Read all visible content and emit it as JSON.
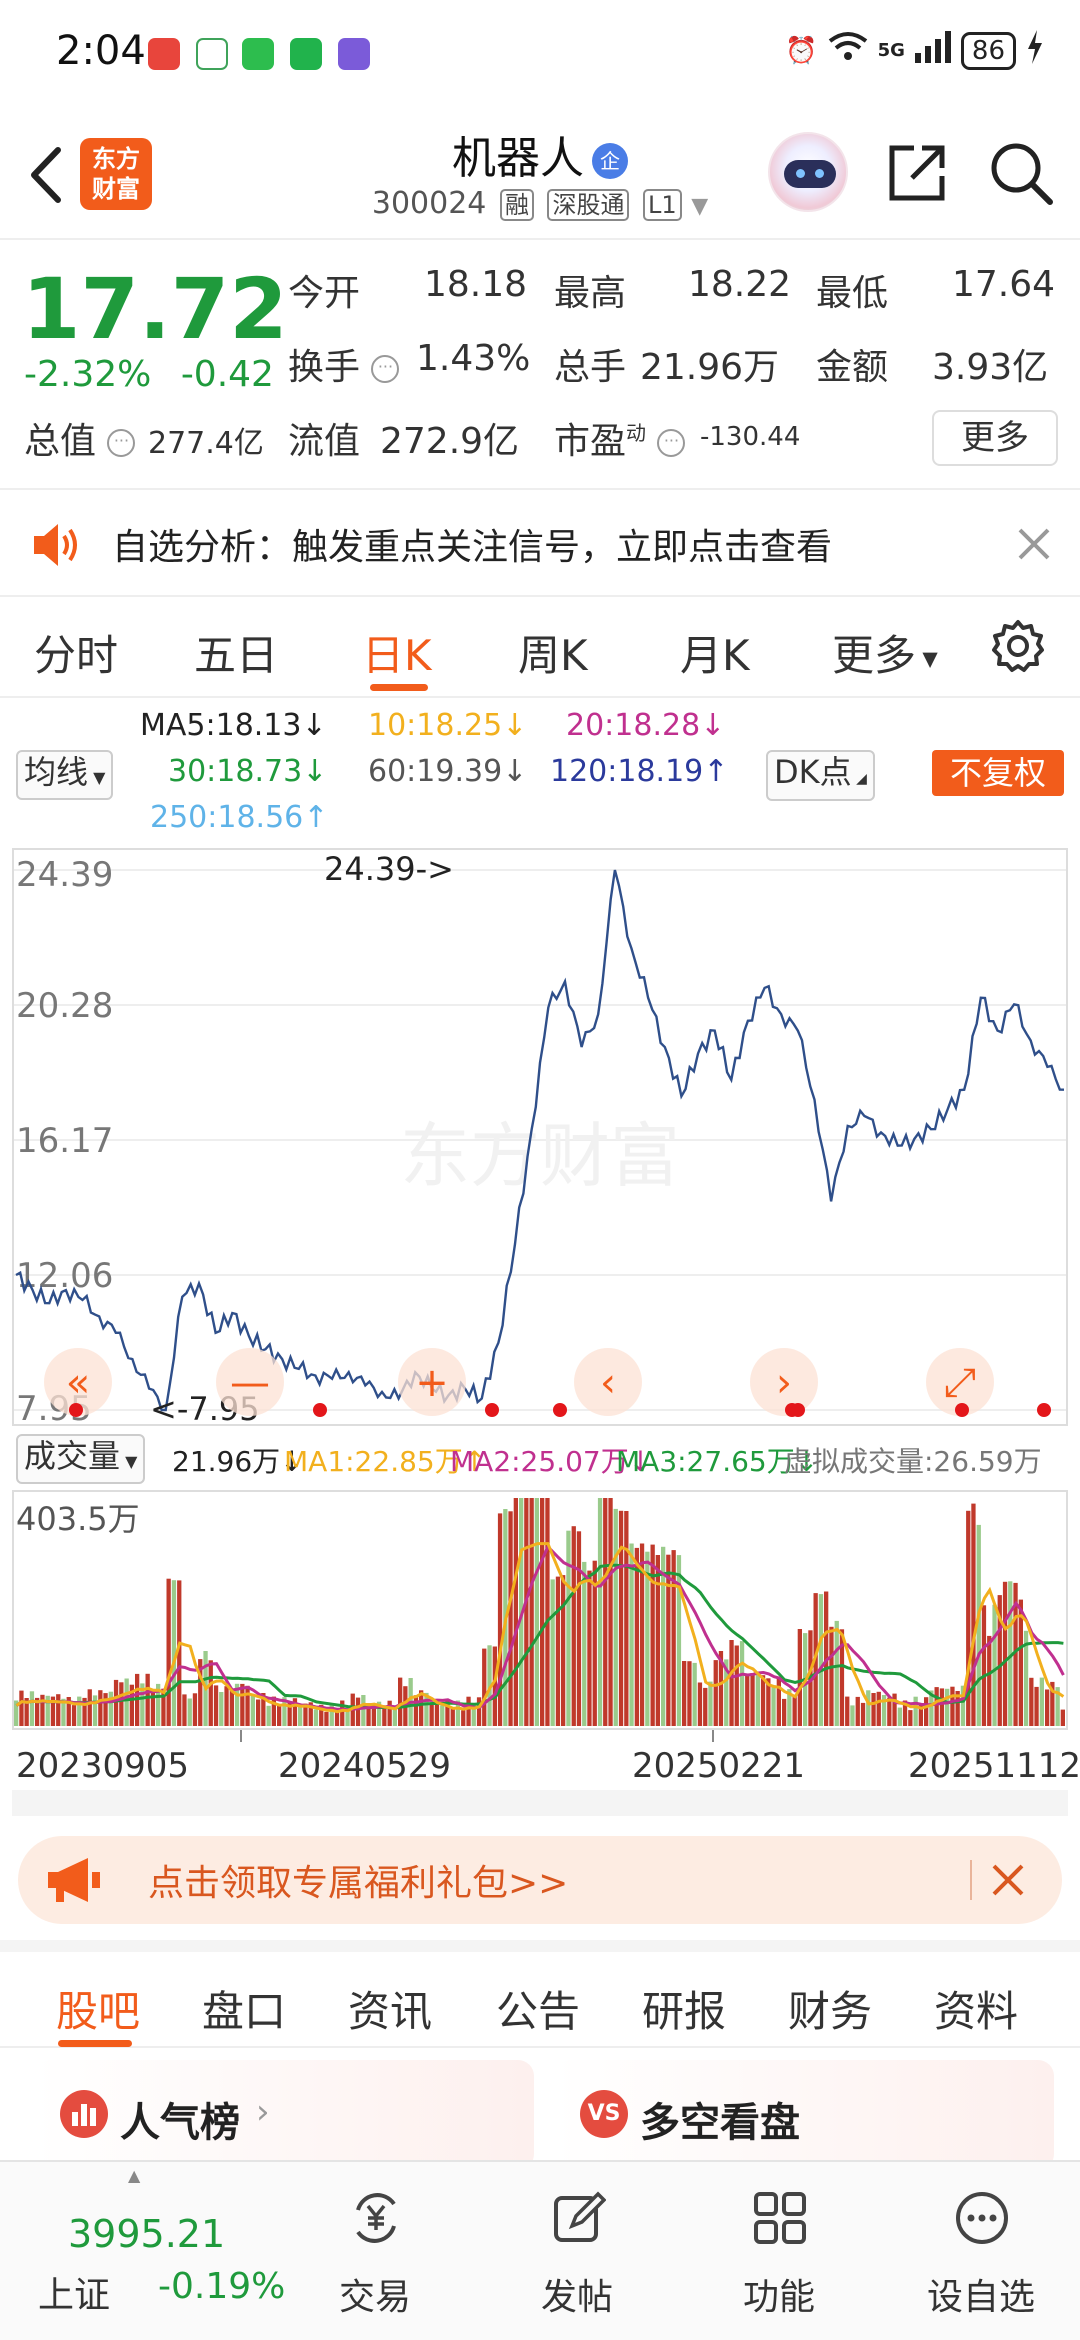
{
  "status_bar": {
    "time": "2:04",
    "battery": "86",
    "network": "5G"
  },
  "header": {
    "title": "机器人",
    "verified_badge": "企",
    "code": "300024",
    "tags": [
      "融",
      "深股通",
      "L1"
    ],
    "logo_text": [
      "东方",
      "财富"
    ],
    "icons": [
      "back-arrow-icon",
      "robot-avatar-icon",
      "share-icon",
      "search-icon"
    ]
  },
  "quote": {
    "price": "17.72",
    "change_pct": "-2.32%",
    "change_abs": "-0.42",
    "open_label": "今开",
    "open": "18.18",
    "high_label": "最高",
    "high": "18.22",
    "low_label": "最低",
    "low": "17.64",
    "turnover_label": "换手",
    "turnover": "1.43%",
    "volume_label": "总手",
    "volume": "21.96万",
    "amount_label": "金额",
    "amount": "3.93亿",
    "mktcap_label": "总值",
    "mktcap": "277.4亿",
    "float_label": "流值",
    "float": "272.9亿",
    "pe_label": "市盈",
    "pe_sup": "动",
    "pe": "-130.44",
    "more": "更多"
  },
  "notice": {
    "text": "自选分析：触发重点关注信号，立即点击查看"
  },
  "kline_tabs": {
    "items": [
      "分时",
      "五日",
      "日K",
      "周K",
      "月K",
      "更多"
    ],
    "active": "日K"
  },
  "ma": {
    "selector": "均线",
    "ma5": "MA5:18.13↓",
    "ma10": "10:18.25↓",
    "ma20": "20:18.28↓",
    "ma30": "30:18.73↓",
    "ma60": "60:19.39↓",
    "ma120": "120:18.19↑",
    "ma250": "250:18.56↑",
    "dk": "DK点",
    "nofq": "不复权",
    "colors": {
      "ma5": "#222222",
      "ma10": "#f2b01e",
      "ma20": "#c0308f",
      "ma30": "#1f9a3c",
      "ma60": "#555555",
      "ma120": "#2b3a9c",
      "ma250": "#5fb3e8"
    }
  },
  "chart": {
    "y_ticks": [
      "24.39",
      "20.28",
      "16.17",
      "12.06",
      "7.95"
    ],
    "max_label": "24.39->",
    "min_label": "<-7.95",
    "watermark": "东方财富",
    "line_color": "#2f4f8a"
  },
  "volume": {
    "selector": "成交量",
    "vol": "21.96万↓",
    "ma1": "MA1:22.85万↑",
    "ma2": "MA2:25.07万↓",
    "ma3": "MA3:27.65万↓",
    "virtual": "虚拟成交量:26.59万",
    "max_label": "403.5万",
    "colors": {
      "ma1": "#f2b01e",
      "ma2": "#c0308f",
      "ma3": "#1f9a3c",
      "bar": "#c0392b"
    }
  },
  "dates": [
    "20230905",
    "20240529",
    "20250221",
    "20251112"
  ],
  "chart_data": {
    "type": "line",
    "title": "",
    "xlabel": "",
    "ylabel": "",
    "x": [
      "20230905",
      "20240529",
      "20250221",
      "20251112"
    ],
    "ylim": [
      7.95,
      24.39
    ],
    "series": [
      {
        "values": [
          12.06,
          11.6,
          11.2,
          11.6,
          11.3,
          10.8,
          10.3,
          9.5,
          8.6,
          7.95,
          11.4,
          11.8,
          10.3,
          10.9,
          10.2,
          9.8,
          9.5,
          9.2,
          9.0,
          8.9,
          9.1,
          8.7,
          8.5,
          8.3,
          9.1,
          8.6,
          8.4,
          8.6,
          8.3,
          10.0,
          13.0,
          16.5,
          20.2,
          21.0,
          19.0,
          20.0,
          24.39,
          22.0,
          20.5,
          19.0,
          17.5,
          18.8,
          19.5,
          18.0,
          19.8,
          20.8,
          20.0,
          19.5,
          17.4,
          14.3,
          16.6,
          16.9,
          16.4,
          16.0,
          16.2,
          16.5,
          17.1,
          17.7,
          20.5,
          19.5,
          20.3,
          19.2,
          18.4,
          17.7
        ]
      }
    ],
    "y_ticks": [
      "24.39",
      "20.28",
      "16.17",
      "12.06",
      "7.95"
    ],
    "volume_max": "403.5万"
  },
  "promo": {
    "text": "点击领取专属福利礼包>>"
  },
  "sec_tabs": {
    "items": [
      "股吧",
      "盘口",
      "资讯",
      "公告",
      "研报",
      "财务",
      "资料"
    ],
    "active": "股吧"
  },
  "cards": [
    {
      "title": "人气榜",
      "icon": "chart-rank-icon"
    },
    {
      "title": "多空看盘",
      "icon": "vs-icon",
      "icon_text": "VS"
    }
  ],
  "bottom_nav": {
    "index_value": "3995.21",
    "index_name": "上证",
    "index_change": "-0.19%",
    "items": [
      "交易",
      "发帖",
      "功能",
      "设自选"
    ]
  }
}
